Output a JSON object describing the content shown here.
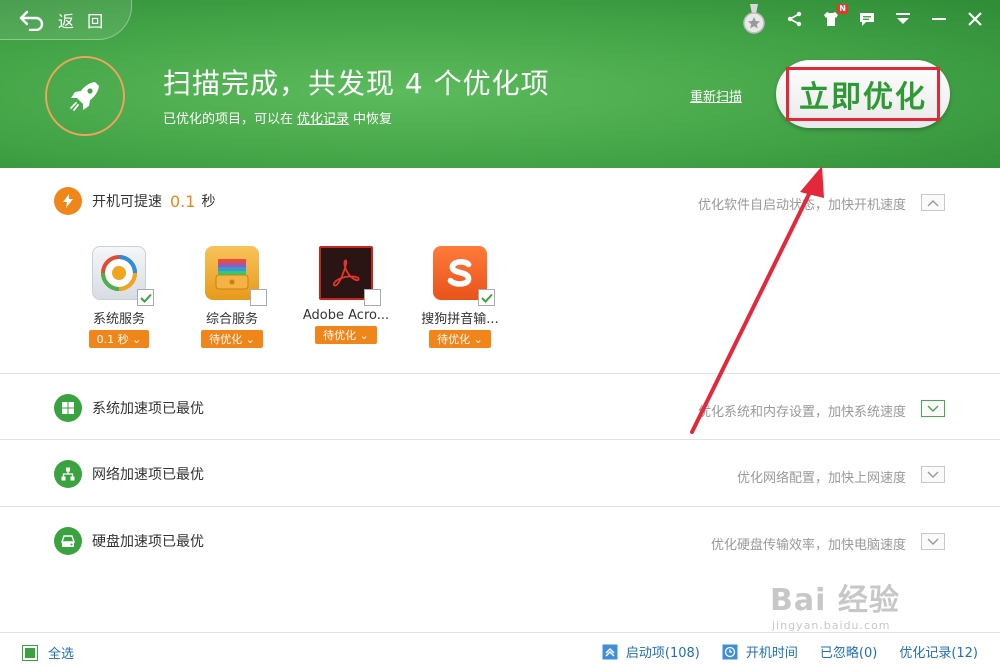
{
  "header": {
    "back_label": "返 回",
    "title": "扫描完成，共发现  4  个优化项",
    "subtitle_prefix": "已优化的项目，可以在",
    "subtitle_link": "优化记录",
    "subtitle_suffix": "中恢复",
    "rescan_label": "重新扫描",
    "optimize_label": "立即优化",
    "notification_badge": "N",
    "icons": [
      "medal-icon",
      "share-icon",
      "shirt-icon",
      "chat-icon",
      "menu-icon",
      "minimize-icon",
      "close-icon"
    ]
  },
  "boot": {
    "title": "开机可提速",
    "speed": "0.1",
    "unit": "秒",
    "desc": "优化软件自启动状态，加快开机速度",
    "apps": [
      {
        "name": "系统服务",
        "tag": "0.1 秒 ⌄",
        "checked": true
      },
      {
        "name": "综合服务",
        "tag": "待优化 ⌄",
        "checked": false
      },
      {
        "name": "Adobe Acro...",
        "tag": "待优化 ⌄",
        "checked": false
      },
      {
        "name": "搜狗拼音输...",
        "tag": "待优化 ⌄",
        "checked": true
      }
    ]
  },
  "system": {
    "title": "系统加速项已最优",
    "desc": "优化系统和内存设置，加快系统速度"
  },
  "network": {
    "title": "网络加速项已最优",
    "desc": "优化网络配置，加快上网速度"
  },
  "disk": {
    "title": "硬盘加速项已最优",
    "desc": "优化硬盘传输效率，加快电脑速度"
  },
  "footer": {
    "select_all": "全选",
    "startup_items": "启动项(108)",
    "boot_time": "开机时间",
    "ignored": "已忽略(0)",
    "records": "优化记录(12)"
  },
  "watermark": {
    "brand": "Bai 经验",
    "url": "jingyan.baidu.com"
  },
  "colors": {
    "header_green": "#43a447",
    "accent_orange": "#f08519",
    "link_blue": "#1f6fb7",
    "annotation_red": "#e5273a"
  }
}
